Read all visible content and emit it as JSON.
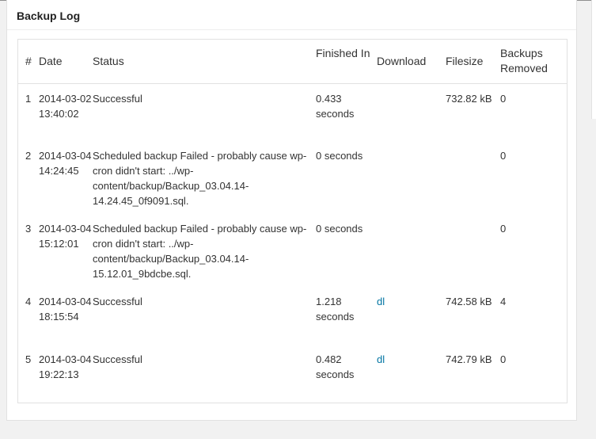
{
  "panel": {
    "title": "Backup Log"
  },
  "table": {
    "headers": {
      "num": "#",
      "date": "Date",
      "status": "Status",
      "finished_in": "Finished In",
      "download": "Download",
      "filesize": "Filesize",
      "backups_removed": "Backups Removed"
    },
    "rows": [
      {
        "num": "1",
        "date": "2014-03-02 13:40:02",
        "status": "Successful",
        "finished_in": "0.433 seconds",
        "download": "",
        "filesize": "732.82 kB",
        "backups_removed": "0"
      },
      {
        "num": "2",
        "date": "2014-03-04 14:24:45",
        "status": "Scheduled backup Failed - probably cause wp-cron didn't start: ../wp-content/backup/Backup_03.04.14-14.24.45_0f9091.sql.",
        "finished_in": "0 seconds",
        "download": "",
        "filesize": "",
        "backups_removed": "0"
      },
      {
        "num": "3",
        "date": "2014-03-04 15:12:01",
        "status": "Scheduled backup Failed - probably cause wp-cron didn't start: ../wp-content/backup/Backup_03.04.14-15.12.01_9bdcbe.sql.",
        "finished_in": "0 seconds",
        "download": "",
        "filesize": "",
        "backups_removed": "0"
      },
      {
        "num": "4",
        "date": "2014-03-04 18:15:54",
        "status": "Successful",
        "finished_in": "1.218 seconds",
        "download": "dl",
        "filesize": "742.58 kB",
        "backups_removed": "4"
      },
      {
        "num": "5",
        "date": "2014-03-04 19:22:13",
        "status": "Successful",
        "finished_in": "0.482 seconds",
        "download": "dl",
        "filesize": "742.79 kB",
        "backups_removed": "0"
      }
    ]
  },
  "colors": {
    "link": "#0074a2",
    "background": "#f1f1f1",
    "panel": "#ffffff",
    "border": "#e1e1e1"
  }
}
